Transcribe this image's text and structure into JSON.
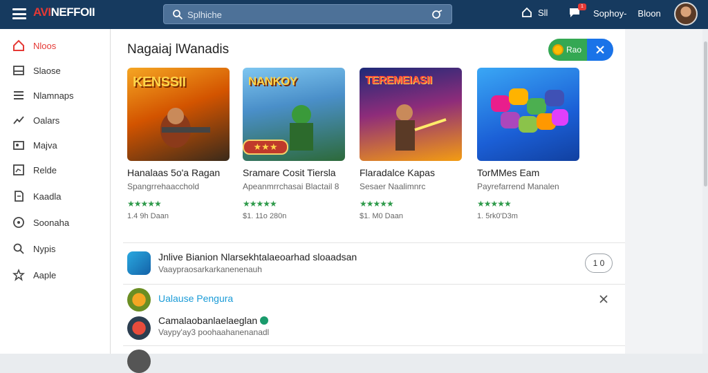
{
  "header": {
    "logo_a": "AVI",
    "logo_b": "NEFFOII",
    "search_placeholder": "Splhiche",
    "bell_label": "Sll",
    "notif_badge": "1",
    "user_first": "Sophoy-",
    "user_last": "Bloon"
  },
  "sidebar": {
    "items": [
      {
        "label": "Nloos",
        "icon": "home-icon",
        "active": true
      },
      {
        "label": "Slaose",
        "icon": "tray-icon"
      },
      {
        "label": "Nlamnaps",
        "icon": "list-icon"
      },
      {
        "label": "Oalars",
        "icon": "trend-icon"
      },
      {
        "label": "Majva",
        "icon": "gallery-icon"
      },
      {
        "label": "Relde",
        "icon": "chart-box-icon"
      },
      {
        "label": "Kaadla",
        "icon": "document-icon"
      },
      {
        "label": "Soonaha",
        "icon": "info-circle-icon"
      },
      {
        "label": "Nypis",
        "icon": "search-icon"
      },
      {
        "label": "Aaple",
        "icon": "star-outline-icon"
      }
    ]
  },
  "main": {
    "section_title": "Nagaiaj lWanadis",
    "pill_label": "Rao",
    "cards": [
      {
        "art_text": "KENSSII",
        "title": "Hanalaas 5o'a Ragan",
        "sub": "Spangrrehaacchold",
        "meta": "1.4 9h Daan",
        "rating": "★★★★★"
      },
      {
        "art_text": "NANKOY",
        "title": "Sramare Cosit Tiersla",
        "sub": "Apeanmrrchasai Blactail 8",
        "meta": "$1. 11o 280n",
        "rating": "★★★★★"
      },
      {
        "art_text": "TEREMEIASII",
        "title": "Flaradalce Kapas",
        "sub": "Sesaer Naalimnrc",
        "meta": "$1. M0 Daan",
        "rating": "★★★★★"
      },
      {
        "art_text": "",
        "title": "TorMMes Eam",
        "sub": "Payrefarrend Manalen",
        "meta": "1. 5rk0'D3m",
        "rating": "★★★★★"
      }
    ],
    "list": [
      {
        "title": "Jnlive Bianion Nlarsekhtalaeoarhad sloaadsan",
        "sub": "Vaaypraosarkarkanenenauh",
        "button": "1 0"
      },
      {
        "title": "Ualause Pengura",
        "sub": "",
        "link": true
      },
      {
        "title": "Camalaobanlaelaeglan",
        "sub": "Vaypy'ay3 poohaahanenanadl",
        "verified": true
      }
    ]
  },
  "colors": {
    "topbar": "#163a5f",
    "accent_red": "#e53935",
    "accent_green": "#34a853",
    "accent_blue": "#1a73e8",
    "link": "#1a9bd7"
  }
}
